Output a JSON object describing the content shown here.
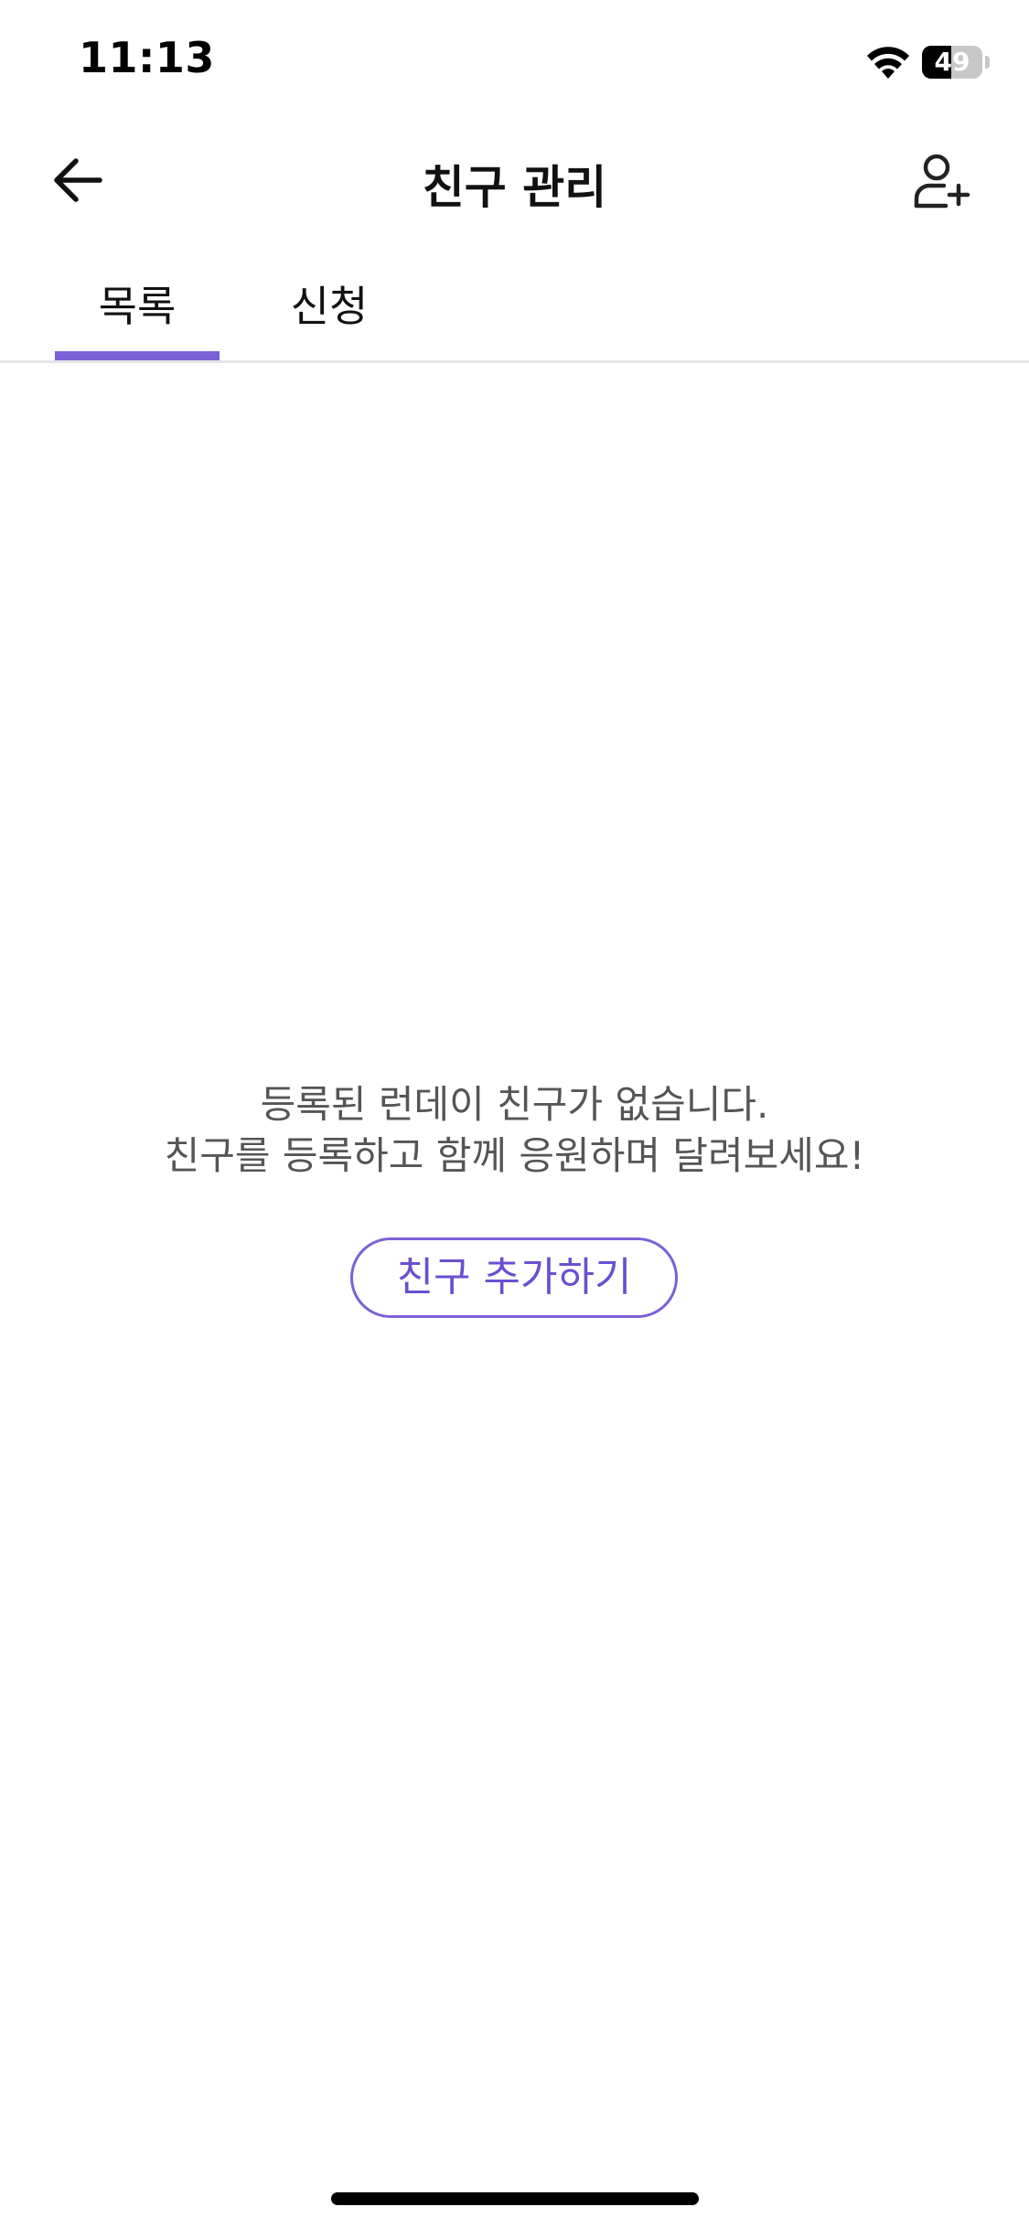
{
  "status_bar": {
    "time": "11:13",
    "battery_level": "49",
    "battery_fraction": 0.49,
    "icons": [
      "wifi-icon",
      "battery-icon"
    ]
  },
  "header": {
    "title": "친구 관리",
    "back_icon": "arrow-left-icon",
    "action_icon": "user-plus-icon"
  },
  "tabs": [
    {
      "label": "목록",
      "active": true
    },
    {
      "label": "신청",
      "active": false
    }
  ],
  "empty_state": {
    "line1": "등록된 런데이 친구가 없습니다.",
    "line2": "친구를 등록하고 함께 응원하며 달려보세요!",
    "cta_label": "친구 추가하기"
  },
  "colors": {
    "accent": "#7b61d6",
    "cta_text": "#6a4fd0",
    "body_text": "#555555",
    "divider": "#e6e6e6"
  }
}
